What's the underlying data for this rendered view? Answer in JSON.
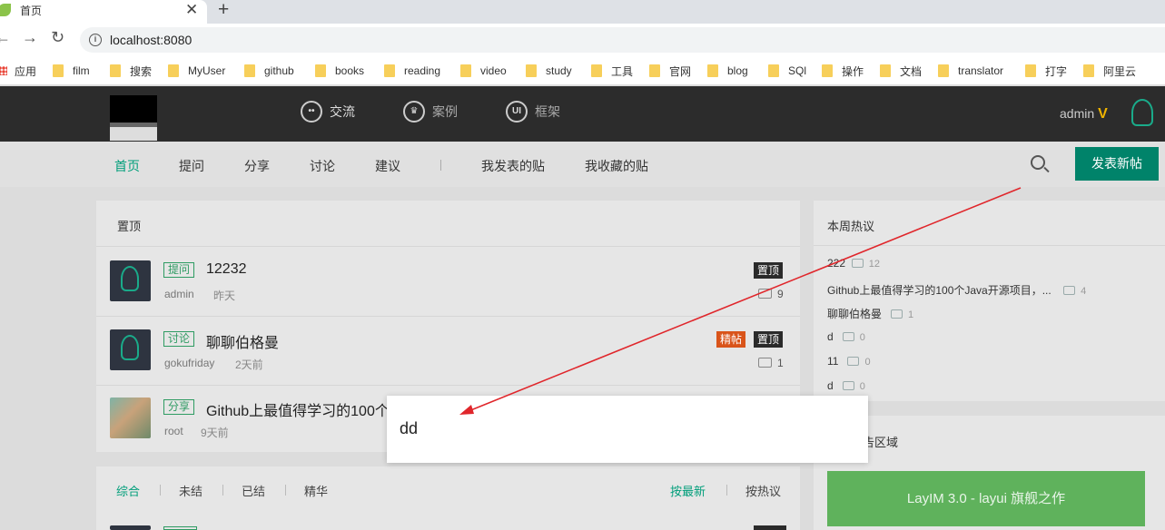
{
  "browser": {
    "tab_title": "首页",
    "close_glyph": "✕",
    "new_tab_glyph": "+",
    "url": "localhost:8080",
    "back_glyph": "←",
    "forward_glyph": "→",
    "reload_glyph": "↻",
    "bookmarks": [
      "应用",
      "film",
      "搜索",
      "MyUser",
      "github",
      "books",
      "reading",
      "video",
      "study",
      "工具",
      "官网",
      "blog",
      "SQl",
      "操作",
      "文档",
      "translator",
      "打字",
      "阿里云"
    ]
  },
  "header": {
    "nav": [
      {
        "label": "交流",
        "icon": "chat-icon",
        "glyph": "••"
      },
      {
        "label": "案例",
        "icon": "crown-icon",
        "glyph": "♛"
      },
      {
        "label": "框架",
        "icon": "ui-icon",
        "glyph": "UI"
      }
    ],
    "user": "admin",
    "vip_glyph": "V"
  },
  "subnav": {
    "items": [
      "首页",
      "提问",
      "分享",
      "讨论",
      "建议"
    ],
    "user_items": [
      "我发表的贴",
      "我收藏的贴"
    ],
    "post_button": "发表新帖"
  },
  "pinned": {
    "title": "置顶",
    "posts": [
      {
        "tag": "提问",
        "title": "12232",
        "user": "admin",
        "time": "昨天",
        "badges": [
          "置顶"
        ],
        "comments": "9"
      },
      {
        "tag": "讨论",
        "title": "聊聊伯格曼",
        "user": "gokufriday",
        "time": "2天前",
        "badges": [
          "精帖",
          "置顶"
        ],
        "comments": "1"
      },
      {
        "tag": "分享",
        "title": "Github上最值得学习的100个",
        "user": "root",
        "time": "9天前"
      }
    ]
  },
  "filters": {
    "left": [
      "综合",
      "未结",
      "已结",
      "精华"
    ],
    "right": [
      "按最新",
      "按热议"
    ]
  },
  "hot": {
    "title": "本周热议",
    "items": [
      {
        "title": "222",
        "count": "12"
      },
      {
        "title": "Github上最值得学习的100个Java开源项目，...",
        "count": "4"
      },
      {
        "title": "聊聊伯格曼",
        "count": "1"
      },
      {
        "title": "d",
        "count": "0"
      },
      {
        "title": "11",
        "count": "0"
      },
      {
        "title": "d",
        "count": "0"
      }
    ]
  },
  "ad": {
    "title": "作为广告区域",
    "button": "LayIM 3.0 - layui 旗舰之作"
  },
  "popup": {
    "text": "dd"
  },
  "colors": {
    "accent": "#009e7a",
    "arrow": "#e0262b",
    "ad": "#5fb25c"
  }
}
